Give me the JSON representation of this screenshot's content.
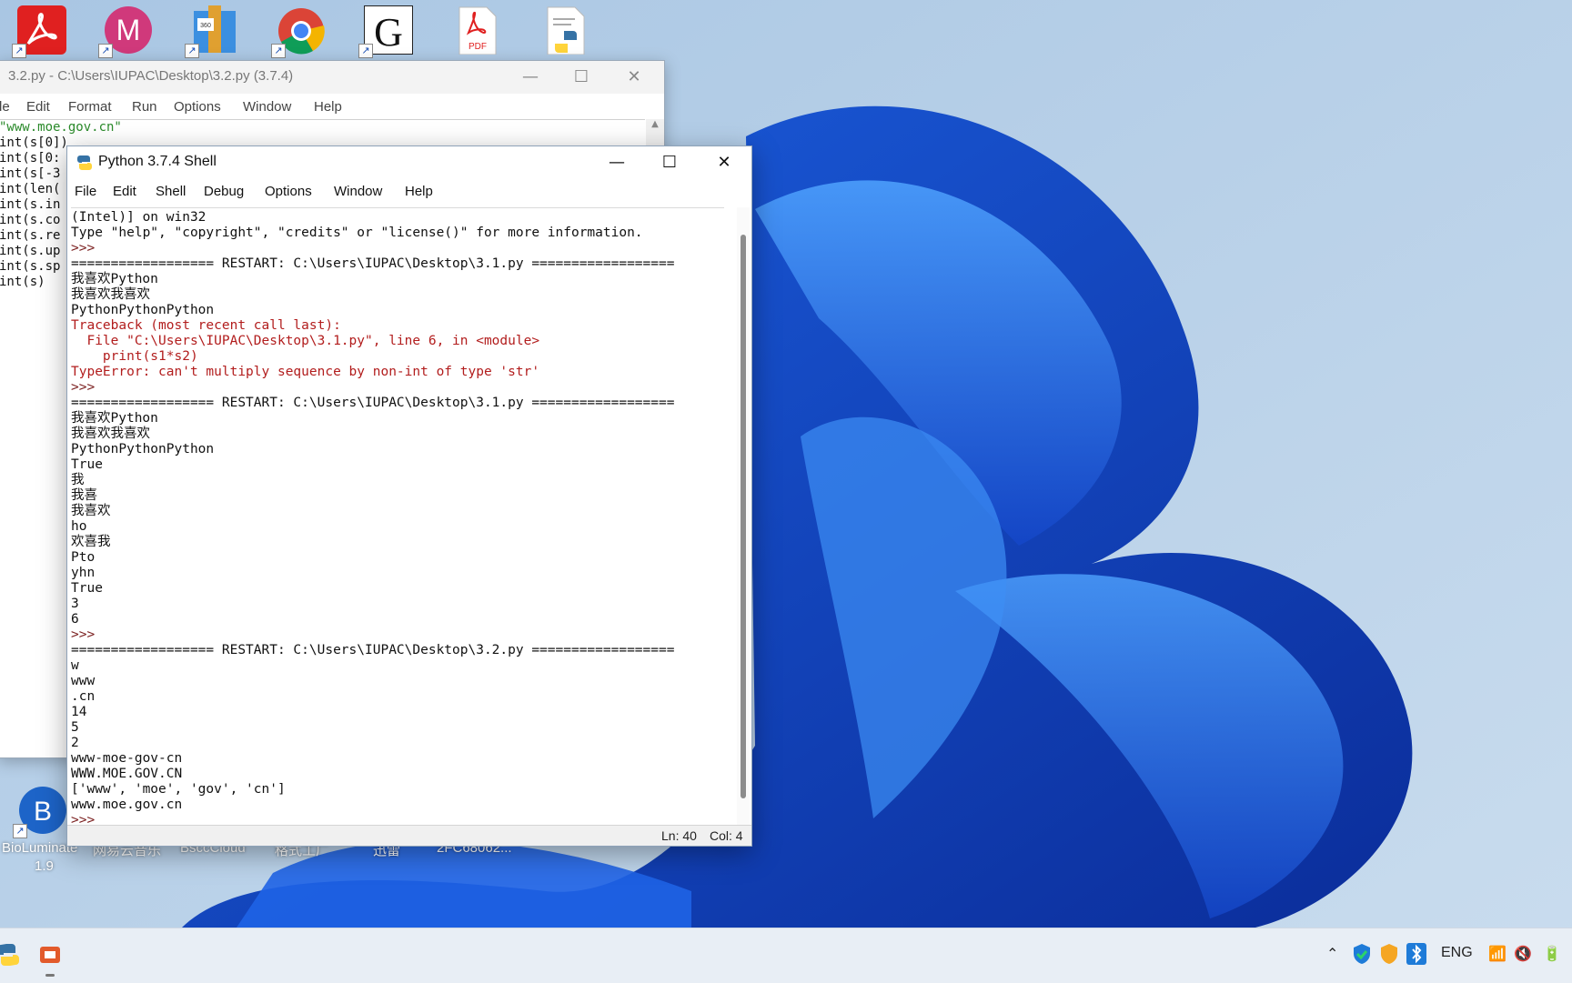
{
  "desktop": {
    "top_icons": [
      {
        "name": "acrobat-reader-icon"
      },
      {
        "name": "m-app-icon",
        "glyph": "M"
      },
      {
        "name": "winrar-icon",
        "text": "360\nZIP"
      },
      {
        "name": "chrome-icon"
      },
      {
        "name": "gaussview-icon"
      },
      {
        "name": "pdf-file-icon",
        "text": "PDF"
      },
      {
        "name": "python-file-icon"
      }
    ],
    "bottom_labels": {
      "bioluminate_line1": "BioLuminate",
      "bioluminate_line2": "1.9",
      "netease": "网易云音乐",
      "bscc": "BsccCloud",
      "geshi": "格式工厂",
      "xunlei": "迅雷",
      "file": "2FC68062..."
    },
    "bioluminate_glyph": "B"
  },
  "editor": {
    "title": "3.2.py - C:\\Users\\IUPAC\\Desktop\\3.2.py (3.7.4)",
    "menu": [
      "le",
      "Edit",
      "Format",
      "Run",
      "Options",
      "Window",
      "Help"
    ],
    "lines": [
      "\"www.moe.gov.cn\"",
      "int(s[0])",
      "int(s[0:",
      "int(s[-3",
      "int(len(",
      "int(s.in",
      "int(s.co",
      "int(s.re",
      "int(s.up",
      "int(s.sp",
      "int(s)"
    ]
  },
  "shell": {
    "title": "Python 3.7.4 Shell",
    "menu": [
      "File",
      "Edit",
      "Shell",
      "Debug",
      "Options",
      "Window",
      "Help"
    ],
    "lines": [
      {
        "t": "(Intel)] on win32",
        "c": ""
      },
      {
        "t": "Type \"help\", \"copyright\", \"credits\" or \"license()\" for more information.",
        "c": ""
      },
      {
        "t": ">>> ",
        "c": "prompt"
      },
      {
        "t": "================== RESTART: C:\\Users\\IUPAC\\Desktop\\3.1.py ==================",
        "c": ""
      },
      {
        "t": "我喜欢Python",
        "c": ""
      },
      {
        "t": "我喜欢我喜欢",
        "c": ""
      },
      {
        "t": "PythonPythonPython",
        "c": ""
      },
      {
        "t": "Traceback (most recent call last):",
        "c": "err"
      },
      {
        "t": "  File \"C:\\Users\\IUPAC\\Desktop\\3.1.py\", line 6, in <module>",
        "c": "err"
      },
      {
        "t": "    print(s1*s2)",
        "c": "err"
      },
      {
        "t": "TypeError: can't multiply sequence by non-int of type 'str'",
        "c": "err"
      },
      {
        "t": ">>> ",
        "c": "prompt"
      },
      {
        "t": "================== RESTART: C:\\Users\\IUPAC\\Desktop\\3.1.py ==================",
        "c": ""
      },
      {
        "t": "我喜欢Python",
        "c": ""
      },
      {
        "t": "我喜欢我喜欢",
        "c": ""
      },
      {
        "t": "PythonPythonPython",
        "c": ""
      },
      {
        "t": "True",
        "c": ""
      },
      {
        "t": "我",
        "c": ""
      },
      {
        "t": "我喜",
        "c": ""
      },
      {
        "t": "我喜欢",
        "c": ""
      },
      {
        "t": "ho",
        "c": ""
      },
      {
        "t": "欢喜我",
        "c": ""
      },
      {
        "t": "Pto",
        "c": ""
      },
      {
        "t": "yhn",
        "c": ""
      },
      {
        "t": "True",
        "c": ""
      },
      {
        "t": "3",
        "c": ""
      },
      {
        "t": "6",
        "c": ""
      },
      {
        "t": ">>> ",
        "c": "prompt"
      },
      {
        "t": "================== RESTART: C:\\Users\\IUPAC\\Desktop\\3.2.py ==================",
        "c": ""
      },
      {
        "t": "w",
        "c": ""
      },
      {
        "t": "www",
        "c": ""
      },
      {
        "t": ".cn",
        "c": ""
      },
      {
        "t": "14",
        "c": ""
      },
      {
        "t": "5",
        "c": ""
      },
      {
        "t": "2",
        "c": ""
      },
      {
        "t": "www-moe-gov-cn",
        "c": ""
      },
      {
        "t": "WWW.MOE.GOV.CN",
        "c": ""
      },
      {
        "t": "['www', 'moe', 'gov', 'cn']",
        "c": ""
      },
      {
        "t": "www.moe.gov.cn",
        "c": ""
      },
      {
        "t": ">>> ",
        "c": "prompt"
      }
    ],
    "status_ln": "Ln: 40",
    "status_col": "Col: 4"
  },
  "taskbar": {
    "lang": "ENG"
  }
}
